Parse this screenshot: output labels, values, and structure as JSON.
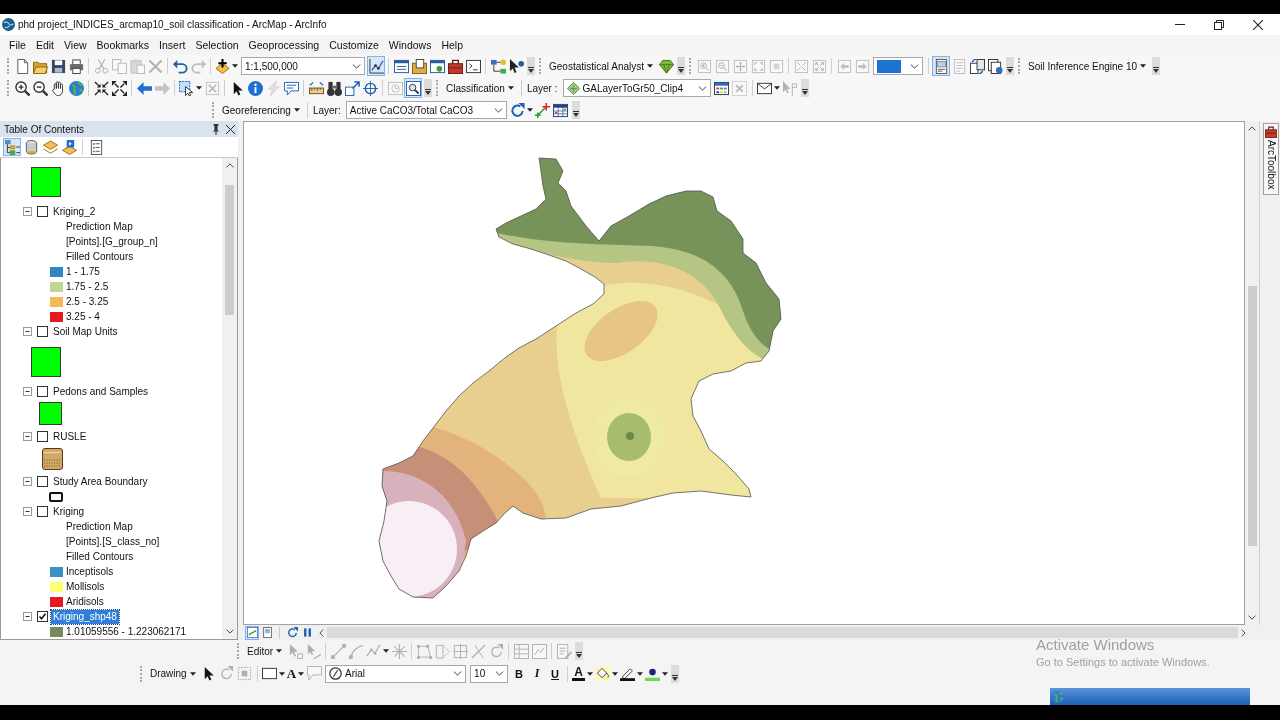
{
  "window": {
    "title": "phd project_INDICES_arcmap10_soil classification - ArcMap - ArcInfo"
  },
  "menu": [
    "File",
    "Edit",
    "View",
    "Bookmarks",
    "Insert",
    "Selection",
    "Geoprocessing",
    "Customize",
    "Windows",
    "Help"
  ],
  "top_toolbars": [
    [
      {
        "items": [
          {
            "kind": "button",
            "disabled": false,
            "pressed": false
          },
          {
            "kind": "button",
            "disabled": false,
            "pressed": false
          },
          {
            "kind": "button",
            "disabled": false,
            "pressed": false
          },
          {
            "kind": "button",
            "disabled": false,
            "pressed": false
          },
          {
            "kind": "sep"
          },
          {
            "kind": "button",
            "disabled": true,
            "pressed": false
          },
          {
            "kind": "button",
            "disabled": true,
            "pressed": false
          },
          {
            "kind": "button",
            "disabled": true,
            "pressed": false
          },
          {
            "kind": "button",
            "disabled": true,
            "pressed": false
          },
          {
            "kind": "sep"
          },
          {
            "kind": "button",
            "disabled": false,
            "pressed": false
          },
          {
            "kind": "button",
            "disabled": true,
            "pressed": false
          },
          {
            "kind": "sep"
          },
          {
            "kind": "split",
            "disabled": false,
            "pressed": false
          },
          {
            "kind": "combo",
            "value": "1:1,500,000"
          },
          {
            "kind": "button",
            "disabled": false,
            "pressed": true
          },
          {
            "kind": "sep"
          },
          {
            "kind": "button",
            "disabled": false,
            "pressed": false
          },
          {
            "kind": "button",
            "disabled": false,
            "pressed": false
          },
          {
            "kind": "button",
            "disabled": false,
            "pressed": false
          },
          {
            "kind": "button",
            "disabled": false,
            "pressed": false
          },
          {
            "kind": "button",
            "disabled": false,
            "pressed": false
          },
          {
            "kind": "sep"
          },
          {
            "kind": "button",
            "disabled": false,
            "pressed": false
          },
          {
            "kind": "button",
            "disabled": false,
            "pressed": false
          }
        ]
      },
      {
        "items": [
          {
            "kind": "menu",
            "label": "Geostatistical Analyst"
          },
          {
            "kind": "button",
            "disabled": false,
            "pressed": false
          }
        ]
      },
      {
        "items": [
          {
            "kind": "button",
            "disabled": true,
            "pressed": false
          },
          {
            "kind": "button",
            "disabled": true,
            "pressed": false
          },
          {
            "kind": "button",
            "disabled": true,
            "pressed": false
          },
          {
            "kind": "button",
            "disabled": true,
            "pressed": false
          },
          {
            "kind": "button",
            "disabled": true,
            "pressed": false
          },
          {
            "kind": "sep"
          },
          {
            "kind": "button",
            "disabled": true,
            "pressed": false
          },
          {
            "kind": "button",
            "disabled": true,
            "pressed": false
          },
          {
            "kind": "sep"
          },
          {
            "kind": "button",
            "disabled": true,
            "pressed": false
          },
          {
            "kind": "button",
            "disabled": true,
            "pressed": false
          },
          {
            "kind": "combo",
            "highlighted": true
          },
          {
            "kind": "sep"
          },
          {
            "kind": "button",
            "disabled": false,
            "pressed": true
          },
          {
            "kind": "button",
            "disabled": true,
            "pressed": false
          },
          {
            "kind": "button",
            "disabled": false,
            "pressed": false
          },
          {
            "kind": "button",
            "disabled": false,
            "pressed": false
          }
        ]
      },
      {
        "items": [
          {
            "kind": "menu",
            "label": "Soil Inference Engine 10"
          }
        ]
      }
    ],
    [
      {
        "items": [
          {
            "kind": "button",
            "disabled": false,
            "pressed": false
          },
          {
            "kind": "button",
            "disabled": false,
            "pressed": false
          },
          {
            "kind": "button",
            "disabled": false,
            "pressed": false
          },
          {
            "kind": "button",
            "disabled": false,
            "pressed": false
          },
          {
            "kind": "sep"
          },
          {
            "kind": "button",
            "disabled": false,
            "pressed": false
          },
          {
            "kind": "button",
            "disabled": false,
            "pressed": false
          },
          {
            "kind": "sep"
          },
          {
            "kind": "button",
            "disabled": false,
            "pressed": false
          },
          {
            "kind": "button",
            "disabled": true,
            "pressed": false
          },
          {
            "kind": "sep"
          },
          {
            "kind": "split",
            "disabled": false,
            "pressed": false
          },
          {
            "kind": "button",
            "disabled": true,
            "pressed": false
          },
          {
            "kind": "sep"
          },
          {
            "kind": "button",
            "disabled": false,
            "pressed": false
          },
          {
            "kind": "button",
            "disabled": false,
            "pressed": false
          },
          {
            "kind": "button",
            "disabled": true,
            "pressed": false
          },
          {
            "kind": "button",
            "disabled": false,
            "pressed": false
          },
          {
            "kind": "sep"
          },
          {
            "kind": "button",
            "disabled": false,
            "pressed": false
          },
          {
            "kind": "button",
            "disabled": false,
            "pressed": false
          },
          {
            "kind": "button",
            "disabled": false,
            "pressed": false
          },
          {
            "kind": "button",
            "disabled": false,
            "pressed": false
          },
          {
            "kind": "sep"
          },
          {
            "kind": "button",
            "disabled": true,
            "pressed": false
          },
          {
            "kind": "button",
            "disabled": false,
            "pressed": true
          }
        ]
      },
      {
        "items": [
          {
            "kind": "menu",
            "label": "Classification"
          },
          {
            "kind": "sep"
          },
          {
            "kind": "label",
            "text": "Layer :"
          },
          {
            "kind": "combo",
            "value": "GALayerToGr50_Clip4"
          },
          {
            "kind": "button",
            "disabled": false,
            "pressed": false
          },
          {
            "kind": "button",
            "disabled": true,
            "pressed": false
          },
          {
            "kind": "sep"
          },
          {
            "kind": "split",
            "disabled": false,
            "pressed": false
          },
          {
            "kind": "button",
            "disabled": true,
            "pressed": false
          }
        ]
      }
    ],
    [
      {
        "items": [
          {
            "kind": "menu",
            "label": "Georeferencing"
          },
          {
            "kind": "sep"
          },
          {
            "kind": "label",
            "text": "Layer:"
          },
          {
            "kind": "combo",
            "value": "Active CaCO3/Total CaCO3"
          },
          {
            "kind": "split",
            "disabled": false,
            "pressed": false
          },
          {
            "kind": "button",
            "disabled": false,
            "pressed": false
          },
          {
            "kind": "button",
            "disabled": false,
            "pressed": false
          }
        ]
      }
    ]
  ],
  "toc": {
    "title": "Table Of Contents",
    "views": [
      {
        "selected": true
      },
      {
        "selected": false
      },
      {
        "selected": false
      },
      {
        "selected": false
      }
    ],
    "layers": [
      {
        "legend": [
          {
            "kind": "polygon",
            "color": "#00ff00"
          }
        ]
      },
      {
        "name": "Kriging_2",
        "expanded": true,
        "checked": false,
        "selected": false,
        "legend": [
          {
            "kind": "heading",
            "lines": [
              "Prediction Map",
              "[Points].[G_group_n]",
              "Filled Contours"
            ]
          },
          {
            "kind": "class",
            "label": "1 - 1.75",
            "color": "#2f86c4"
          },
          {
            "kind": "class",
            "label": "1.75 - 2.5",
            "color": "#c2d694"
          },
          {
            "kind": "class",
            "label": "2.5 - 3.25",
            "color": "#f4b856"
          },
          {
            "kind": "class",
            "label": "3.25 - 4",
            "color": "#e41a1c"
          }
        ]
      },
      {
        "name": "Soil Map Units",
        "expanded": true,
        "checked": false,
        "selected": false,
        "legend": [
          {
            "kind": "polygon",
            "color": "#00ff00"
          }
        ]
      },
      {
        "name": "Pedons and Samples",
        "expanded": true,
        "checked": false,
        "selected": false,
        "legend": [
          {
            "kind": "marker",
            "color": "#00ff00"
          }
        ]
      },
      {
        "name": "RUSLE",
        "expanded": true,
        "checked": false,
        "selected": false,
        "legend": [
          {
            "kind": "raster"
          }
        ]
      },
      {
        "name": "Study Area Boundary",
        "expanded": true,
        "checked": false,
        "selected": false,
        "legend": [
          {
            "kind": "outline"
          }
        ]
      },
      {
        "name": "Kriging",
        "expanded": true,
        "checked": false,
        "selected": false,
        "legend": [
          {
            "kind": "heading",
            "lines": [
              "Prediction Map",
              "[Points].[S_class_no]",
              "Filled Contours"
            ]
          },
          {
            "kind": "class",
            "label": "Inceptisols",
            "color": "#3a8fc4"
          },
          {
            "kind": "class",
            "label": "Mollisols",
            "color": "#ffff73"
          },
          {
            "kind": "class",
            "label": "Aridisols",
            "color": "#e41a1c"
          }
        ]
      },
      {
        "name": "Kriging_shp48",
        "expanded": true,
        "checked": true,
        "selected": true,
        "legend": [
          {
            "kind": "class",
            "label": "1.01059556 - 1.223062171",
            "color": "#768b5c"
          }
        ]
      }
    ]
  },
  "map_view": {
    "views": [
      {
        "selected": true
      },
      {
        "selected": false
      }
    ]
  },
  "side_tabs": [
    {
      "label": "ArcToolbox"
    }
  ],
  "bottom_toolbars": [
    [
      {
        "items": [
          {
            "kind": "menu",
            "label": "Editor"
          },
          {
            "kind": "button",
            "disabled": true,
            "pressed": false
          },
          {
            "kind": "button",
            "disabled": true,
            "pressed": false
          },
          {
            "kind": "sep"
          },
          {
            "kind": "button",
            "disabled": true,
            "pressed": false
          },
          {
            "kind": "button",
            "disabled": true,
            "pressed": false
          },
          {
            "kind": "split",
            "disabled": true,
            "pressed": false
          },
          {
            "kind": "button",
            "disabled": true,
            "pressed": false
          },
          {
            "kind": "sep"
          },
          {
            "kind": "button",
            "disabled": true,
            "pressed": false
          },
          {
            "kind": "button",
            "disabled": true,
            "pressed": false
          },
          {
            "kind": "button",
            "disabled": true,
            "pressed": false
          },
          {
            "kind": "button",
            "disabled": true,
            "pressed": false
          },
          {
            "kind": "button",
            "disabled": true,
            "pressed": false
          },
          {
            "kind": "sep"
          },
          {
            "kind": "button",
            "disabled": true,
            "pressed": false
          },
          {
            "kind": "button",
            "disabled": true,
            "pressed": false
          },
          {
            "kind": "sep"
          },
          {
            "kind": "button",
            "disabled": true,
            "pressed": false
          }
        ]
      }
    ],
    [
      {
        "items": [
          {
            "kind": "menu",
            "label": "Drawing"
          },
          {
            "kind": "button",
            "disabled": false,
            "pressed": false
          },
          {
            "kind": "button",
            "disabled": true,
            "pressed": false
          },
          {
            "kind": "button",
            "disabled": true,
            "pressed": false
          },
          {
            "kind": "sep"
          },
          {
            "kind": "split",
            "disabled": false,
            "pressed": false
          },
          {
            "kind": "split",
            "label": "A",
            "disabled": false,
            "pressed": false
          },
          {
            "kind": "button",
            "disabled": true,
            "pressed": false
          },
          {
            "kind": "combo",
            "value": "Arial"
          },
          {
            "kind": "combo",
            "value": "10"
          },
          {
            "kind": "button",
            "label": "B",
            "disabled": false,
            "pressed": false
          },
          {
            "kind": "button",
            "label": "I",
            "disabled": false,
            "pressed": false
          },
          {
            "kind": "button",
            "label": "U",
            "disabled": false,
            "pressed": false
          },
          {
            "kind": "sep"
          },
          {
            "kind": "split",
            "label": "A",
            "disabled": false,
            "pressed": false
          },
          {
            "kind": "split",
            "disabled": false,
            "pressed": false
          },
          {
            "kind": "split",
            "disabled": false,
            "pressed": false
          },
          {
            "kind": "split",
            "disabled": false,
            "pressed": false
          }
        ]
      }
    ]
  ],
  "activation_notice": {
    "title": "Activate Windows",
    "message": "Go to Settings to activate Windows."
  }
}
